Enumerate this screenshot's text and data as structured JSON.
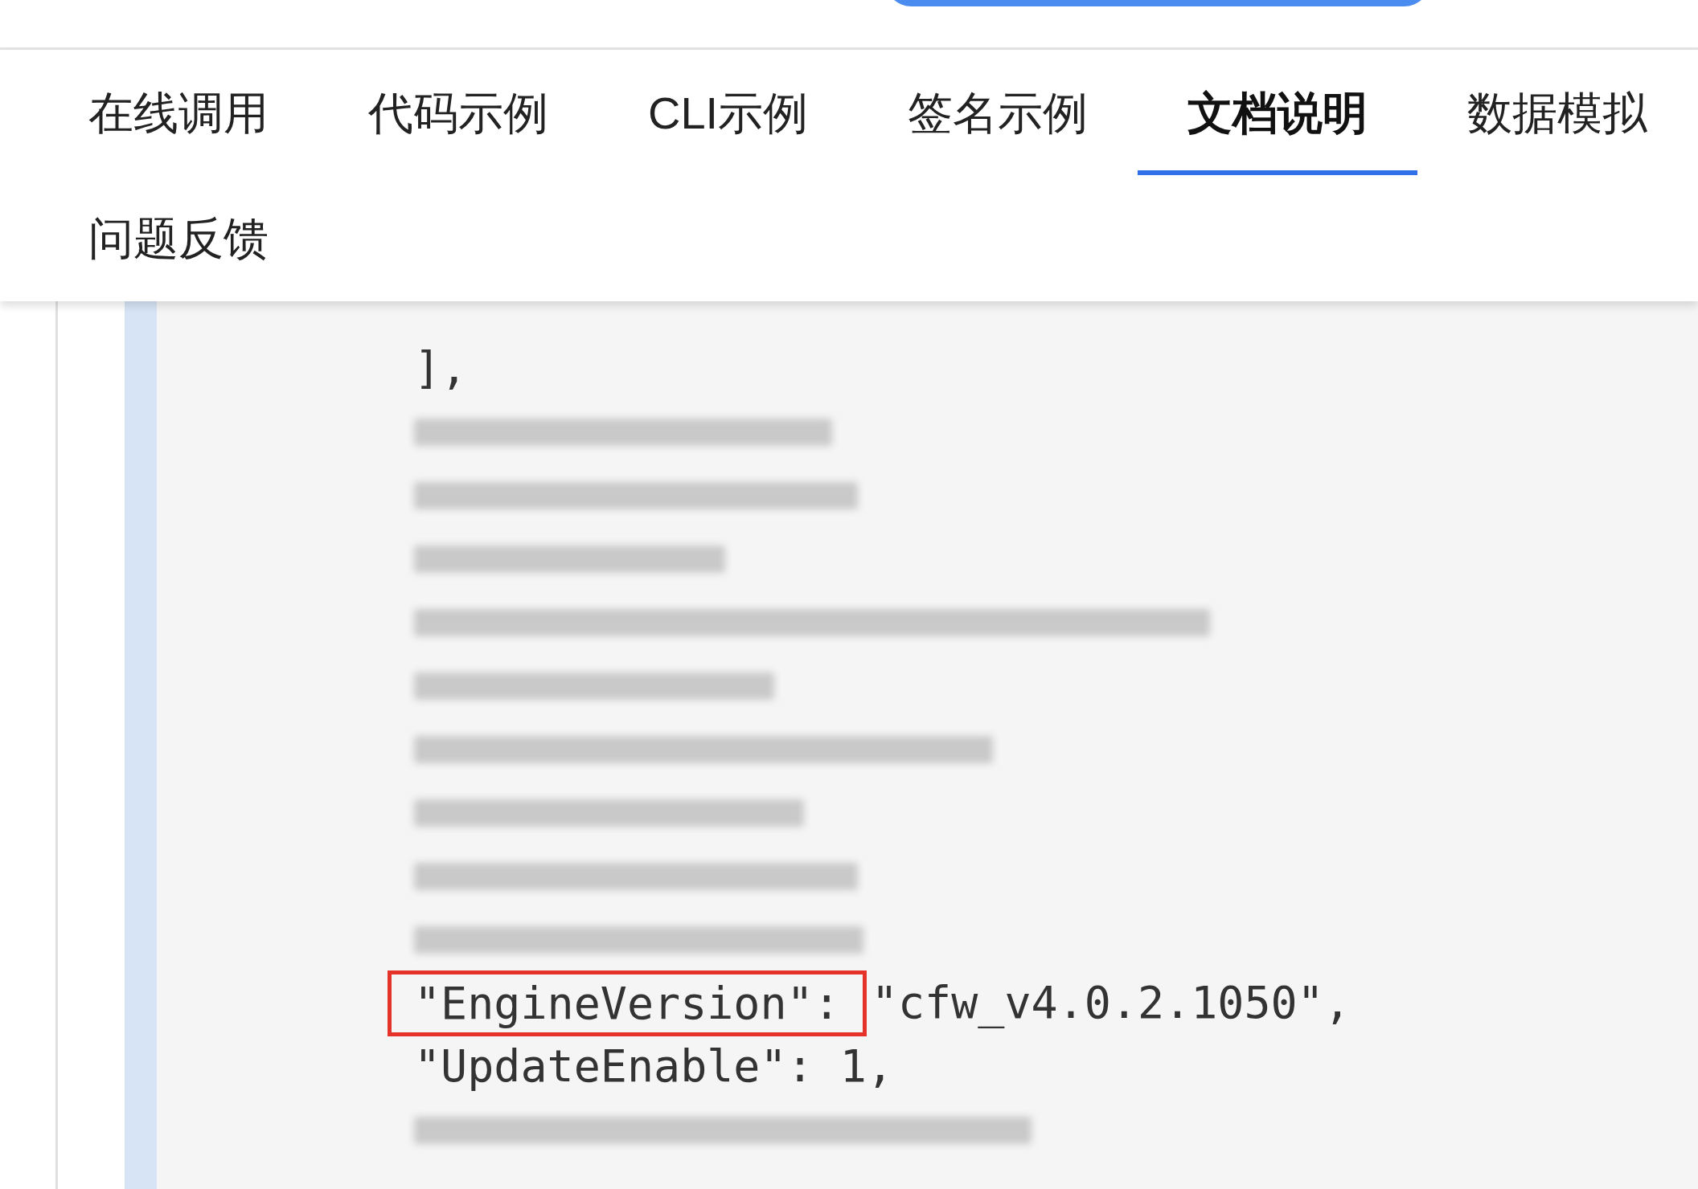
{
  "tabs": [
    {
      "label": "在线调用",
      "selected": false
    },
    {
      "label": "代码示例",
      "selected": false
    },
    {
      "label": "CLI示例",
      "selected": false
    },
    {
      "label": "签名示例",
      "selected": false
    },
    {
      "label": "文档说明",
      "selected": true
    },
    {
      "label": "数据模拟",
      "selected": false
    },
    {
      "label": "问题反馈",
      "selected": false
    }
  ],
  "code_lines": [
    {
      "kind": "text",
      "segments": [
        {
          "text": "],",
          "highlighted": false
        }
      ]
    },
    {
      "kind": "blurred"
    },
    {
      "kind": "blurred"
    },
    {
      "kind": "blurred"
    },
    {
      "kind": "blurred"
    },
    {
      "kind": "blurred"
    },
    {
      "kind": "blurred"
    },
    {
      "kind": "blurred"
    },
    {
      "kind": "blurred"
    },
    {
      "kind": "blurred"
    },
    {
      "kind": "text",
      "segments": [
        {
          "text": "\"EngineVersion\":",
          "highlighted": true
        },
        {
          "text": "\"cfw_v4.0.2.1050\",",
          "highlighted": false
        }
      ]
    },
    {
      "kind": "text",
      "segments": [
        {
          "text": "\"UpdateEnable\": 1,",
          "highlighted": false
        }
      ]
    },
    {
      "kind": "blurred"
    }
  ]
}
